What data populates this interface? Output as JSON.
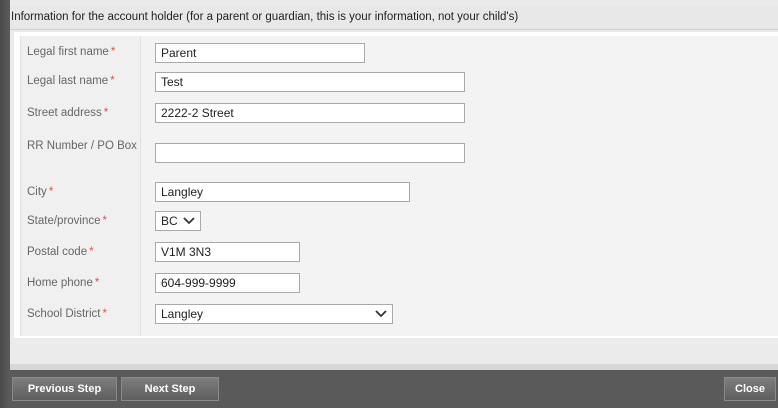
{
  "header": {
    "title": "Information for the account holder (for a parent or guardian, this is your information, not your child's)"
  },
  "form": {
    "required_marker": "*",
    "fields": {
      "first_name": {
        "label": "Legal first name",
        "value": "Parent"
      },
      "last_name": {
        "label": "Legal last name",
        "value": "Test"
      },
      "street": {
        "label": "Street address",
        "value": "2222-2 Street"
      },
      "rr_po": {
        "label": "RR Number / PO Box",
        "value": ""
      },
      "city": {
        "label": "City",
        "value": "Langley"
      },
      "state": {
        "label": "State/province",
        "value": "BC"
      },
      "postal": {
        "label": "Postal code",
        "value": "V1M 3N3"
      },
      "phone": {
        "label": "Home phone",
        "value": "604-999-9999"
      },
      "district": {
        "label": "School District",
        "value": "Langley"
      }
    }
  },
  "footer": {
    "previous_label": "Previous Step",
    "next_label": "Next Step",
    "close_label": "Close"
  },
  "colors": {
    "required": "#d9534f",
    "footer_bg": "#5a5a5a"
  },
  "icons": {
    "dropdown": "chevron-down-icon"
  }
}
